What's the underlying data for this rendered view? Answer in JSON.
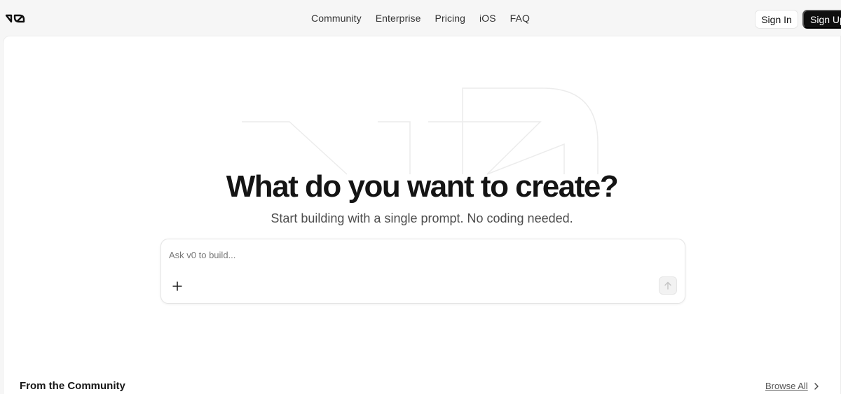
{
  "brand": {
    "logo_icon": "v0-logo-icon"
  },
  "nav": {
    "items": [
      {
        "label": "Community"
      },
      {
        "label": "Enterprise"
      },
      {
        "label": "Pricing"
      },
      {
        "label": "iOS"
      },
      {
        "label": "FAQ"
      }
    ]
  },
  "auth": {
    "sign_in": "Sign In",
    "sign_up": "Sign Up"
  },
  "hero": {
    "title": "What do you want to create?",
    "subtitle": "Start building with a single prompt. No coding needed."
  },
  "prompt": {
    "placeholder": "Ask v0 to build...",
    "value": "",
    "add_icon": "plus-icon",
    "send_icon": "arrow-up-icon"
  },
  "community": {
    "title": "From the Community",
    "browse_label": "Browse All",
    "browse_icon": "chevron-right-icon"
  },
  "colors": {
    "background": "#f6f6f6",
    "panel": "#ffffff",
    "primary_button": "#0f0f0f",
    "text": "#171717"
  }
}
